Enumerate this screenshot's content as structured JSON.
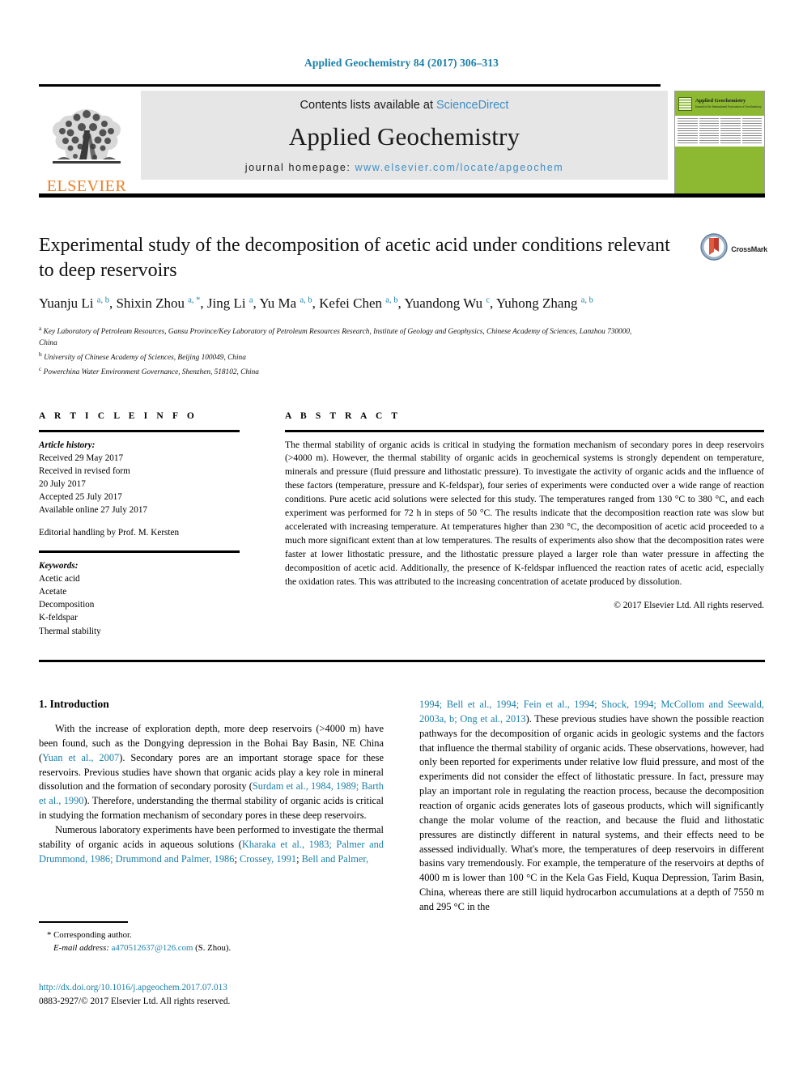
{
  "running_head": "Applied Geochemistry 84 (2017) 306–313",
  "journal_header": {
    "contents_prefix": "Contents lists available at ",
    "contents_link": "ScienceDirect",
    "journal_title": "Applied Geochemistry",
    "homepage_prefix": "journal homepage: ",
    "homepage_url": "www.elsevier.com/locate/apgeochem",
    "publisher": "ELSEVIER",
    "cover_title": "Applied Geochemistry",
    "cover_subtitle": "Journal of the International Association of Geochemistry"
  },
  "crossmark": {
    "label": "CrossMark"
  },
  "article": {
    "title": "Experimental study of the decomposition of acetic acid under conditions relevant to deep reservoirs",
    "authors_html": "Yuanju Li <sup>a, b</sup>, Shixin Zhou <sup>a, *</sup>, Jing Li <sup>a</sup>, Yu Ma <sup>a, b</sup>, Kefei Chen <sup>a, b</sup>, Yuandong Wu <sup>c</sup>, Yuhong Zhang <sup>a, b</sup>",
    "affiliations": [
      {
        "marker": "a",
        "text": "Key Laboratory of Petroleum Resources, Gansu Province/Key Laboratory of Petroleum Resources Research, Institute of Geology and Geophysics, Chinese Academy of Sciences, Lanzhou 730000, China"
      },
      {
        "marker": "b",
        "text": "University of Chinese Academy of Sciences, Beijing 100049, China"
      },
      {
        "marker": "c",
        "text": "Powerchina Water Environment Governance, Shenzhen, 518102, China"
      }
    ]
  },
  "article_info": {
    "heading": "A R T I C L E   I N F O",
    "history_label": "Article history:",
    "history_lines": [
      "Received 29 May 2017",
      "Received in revised form",
      "20 July 2017",
      "Accepted 25 July 2017",
      "Available online 27 July 2017"
    ],
    "editorial": "Editorial handling by Prof. M. Kersten",
    "keywords_label": "Keywords:",
    "keywords": [
      "Acetic acid",
      "Acetate",
      "Decomposition",
      "K-feldspar",
      "Thermal stability"
    ]
  },
  "abstract": {
    "heading": "A B S T R A C T",
    "text": "The thermal stability of organic acids is critical in studying the formation mechanism of secondary pores in deep reservoirs (>4000 m). However, the thermal stability of organic acids in geochemical systems is strongly dependent on temperature, minerals and pressure (fluid pressure and lithostatic pressure). To investigate the activity of organic acids and the influence of these factors (temperature, pressure and K-feldspar), four series of experiments were conducted over a wide range of reaction conditions. Pure acetic acid solutions were selected for this study. The temperatures ranged from 130 °C to 380 °C, and each experiment was performed for 72 h in steps of 50 °C. The results indicate that the decomposition reaction rate was slow but accelerated with increasing temperature. At temperatures higher than 230 °C, the decomposition of acetic acid proceeded to a much more significant extent than at low temperatures. The results of experiments also show that the decomposition rates were faster at lower lithostatic pressure, and the lithostatic pressure played a larger role than water pressure in affecting the decomposition of acetic acid. Additionally, the presence of K-feldspar influenced the reaction rates of acetic acid, especially the oxidation rates. This was attributed to the increasing concentration of acetate produced by dissolution.",
    "copyright": "© 2017 Elsevier Ltd. All rights reserved."
  },
  "body": {
    "section_title": "1. Introduction",
    "left_para_1_html": "With the increase of exploration depth, more deep reservoirs (&gt;4000 m) have been found, such as the Dongying depression in the Bohai Bay Basin, NE China (<span class=\"cite\">Yuan et al., 2007</span>). Secondary pores are an important storage space for these reservoirs. Previous studies have shown that organic acids play a key role in mineral dissolution and the formation of secondary porosity (<span class=\"cite\">Surdam et al., 1984, 1989; Barth et al., 1990</span>). Therefore, understanding the thermal stability of organic acids is critical in studying the formation mechanism of secondary pores in these deep reservoirs.",
    "left_para_2_html": "Numerous laboratory experiments have been performed to investigate the thermal stability of organic acids in aqueous solutions (<span class=\"cite\">Kharaka et al., 1983; Palmer and Drummond, 1986; Drummond and Palmer, 1986</span>; <span class=\"cite\">Crossey, 1991</span>; <span class=\"cite\">Bell and Palmer,</span>",
    "right_para_html": "<span class=\"cite\">1994; Bell et al., 1994; Fein et al., 1994; Shock, 1994; McCollom and Seewald, 2003a, b; Ong et al., 2013</span>). These previous studies have shown the possible reaction pathways for the decomposition of organic acids in geologic systems and the factors that influence the thermal stability of organic acids. These observations, however, had only been reported for experiments under relative low fluid pressure, and most of the experiments did not consider the effect of lithostatic pressure. In fact, pressure may play an important role in regulating the reaction process, because the decomposition reaction of organic acids generates lots of gaseous products, which will significantly change the molar volume of the reaction, and because the fluid and lithostatic pressures are distinctly different in natural systems, and their effects need to be assessed individually. What's more, the temperatures of deep reservoirs in different basins vary tremendously. For example, the temperature of the reservoirs at depths of 4000 m is lower than 100 °C in the Kela Gas Field, Kuqua Depression, Tarim Basin, China, whereas there are still liquid hydrocarbon accumulations at a depth of 7550 m and 295 °C in the"
  },
  "footnote": {
    "star": "*",
    "corresponding": "Corresponding author.",
    "email_label": "E-mail address:",
    "email": "a470512637@126.com",
    "email_suffix": "(S. Zhou)."
  },
  "page_footer": {
    "doi": "http://dx.doi.org/10.1016/j.apgeochem.2017.07.013",
    "issn_line": "0883-2927/© 2017 Elsevier Ltd. All rights reserved."
  },
  "colors": {
    "link": "#1a7fa8",
    "brand_orange": "#ec7e24",
    "cover_green": "#8cb832",
    "banner_gray": "#e6e6e6"
  }
}
